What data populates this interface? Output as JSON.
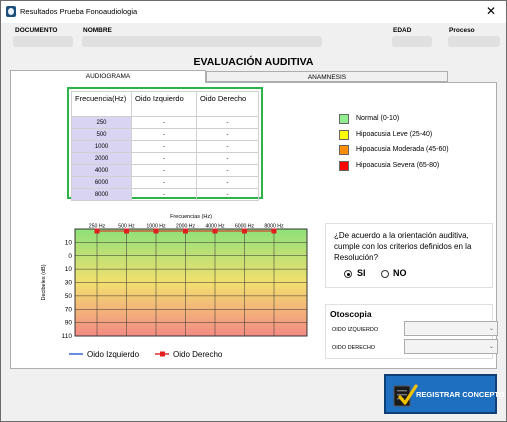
{
  "window": {
    "title": "Resultados Prueba Fonoaudiologia",
    "close_glyph": "✕"
  },
  "header": {
    "documento_label": "DOCUMENTO",
    "nombre_label": "NOMBRE",
    "edad_label": "EDAD",
    "proceso_label": "Proceso"
  },
  "main_title": "EVALUACIÓN AUDITIVA",
  "tabs": [
    {
      "label": "AUDIOGRAMA",
      "active": true
    },
    {
      "label": "ANAMNESIS",
      "active": false
    }
  ],
  "freq_table": {
    "headers": [
      "Frecuencia(Hz)",
      "Oido Izquierdo",
      "Oido Derecho"
    ],
    "rows": [
      {
        "freq": "250",
        "left": "-",
        "right": "-"
      },
      {
        "freq": "500",
        "left": "-",
        "right": "-"
      },
      {
        "freq": "1000",
        "left": "-",
        "right": "-"
      },
      {
        "freq": "2000",
        "left": "-",
        "right": "-"
      },
      {
        "freq": "4000",
        "left": "-",
        "right": "-"
      },
      {
        "freq": "6000",
        "left": "-",
        "right": "-"
      },
      {
        "freq": "8000",
        "left": "-",
        "right": "-"
      }
    ]
  },
  "legend": [
    {
      "label": "Normal (0-10)",
      "color": "#90ee90"
    },
    {
      "label": "Hipoacusia Leve (25-40)",
      "color": "#ffff00"
    },
    {
      "label": "Hipoacusia Moderada (45-60)",
      "color": "#ff8c00"
    },
    {
      "label": "Hipoacusia Severa (65-80)",
      "color": "#ff0000"
    }
  ],
  "chart_data": {
    "type": "line",
    "title": "Frecuencias (Hz)",
    "xlabel": "Frecuencias (Hz)",
    "ylabel": "Decibeles (dB)",
    "categories": [
      "250 Hz",
      "500 Hz",
      "1000 Hz",
      "2000 Hz",
      "4000 Hz",
      "6000 Hz",
      "8000 Hz"
    ],
    "y_ticks": [
      "10",
      "0",
      "10",
      "30",
      "50",
      "70",
      "90",
      "110"
    ],
    "ylim": [
      -10,
      115
    ],
    "y_inverted": true,
    "grid": true,
    "background_gradient": {
      "top": "#8fe07a",
      "middle": "#f2e06f",
      "bottom": "#f38a84"
    },
    "series": [
      {
        "name": "Oido Izquierdo",
        "color": "#2d5ad8",
        "marker": "x",
        "values": []
      },
      {
        "name": "Oido Derecho",
        "color": "#e02020",
        "marker": "square",
        "values": [
          -10,
          -10,
          -10,
          -10,
          -10,
          -10,
          -10
        ]
      }
    ],
    "legend_position": "bottom"
  },
  "question": {
    "text": "¿De acuerdo a la orientación auditiva, cumple con los criterios definidos en la Resolución?",
    "options": [
      {
        "label": "SI",
        "checked": true
      },
      {
        "label": "NO",
        "checked": false
      }
    ]
  },
  "otoscopia": {
    "title": "Otoscopia",
    "left_label": "OIDO IZQUIERDO",
    "right_label": "OIDO DERECHO",
    "left_value": "",
    "right_value": ""
  },
  "register_button": {
    "label": "REGISTRAR CONCEPTO",
    "icon": "clipboard-check-icon"
  }
}
